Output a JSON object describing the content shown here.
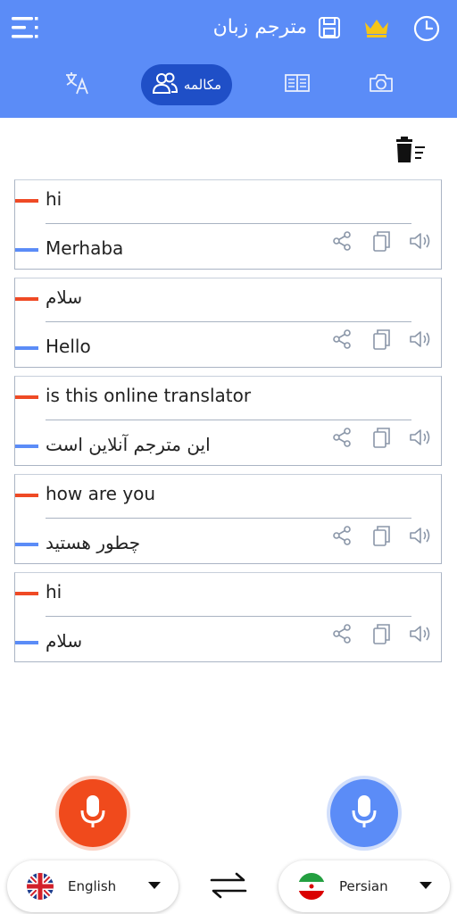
{
  "header": {
    "title": "مترجم زبان",
    "tabs": {
      "conversation_label": "مکالمه"
    }
  },
  "colors": {
    "header_bg": "#5b8cf7",
    "active_tab": "#1f4fc7",
    "source_accent": "#ef4a25",
    "target_accent": "#5b8cf7",
    "crown": "#f5c518"
  },
  "icons": [
    "menu-icon",
    "save-icon",
    "crown-icon",
    "history-icon",
    "translate-icon",
    "people-icon",
    "book-icon",
    "camera-icon",
    "trash-icon",
    "share-icon",
    "copy-icon",
    "speaker-icon",
    "mic-icon",
    "swap-icon",
    "uk-flag-icon",
    "iran-flag-icon"
  ],
  "conversations": [
    {
      "source": "hi",
      "target": "Merhaba"
    },
    {
      "source": "سلام",
      "target": "Hello"
    },
    {
      "source": "is this online translator",
      "target": "این مترجم آنلاین است"
    },
    {
      "source": "how are you",
      "target": "چطور هستید"
    },
    {
      "source": "hi",
      "target": "سلام"
    }
  ],
  "languages": {
    "left": "English",
    "right": "Persian"
  }
}
